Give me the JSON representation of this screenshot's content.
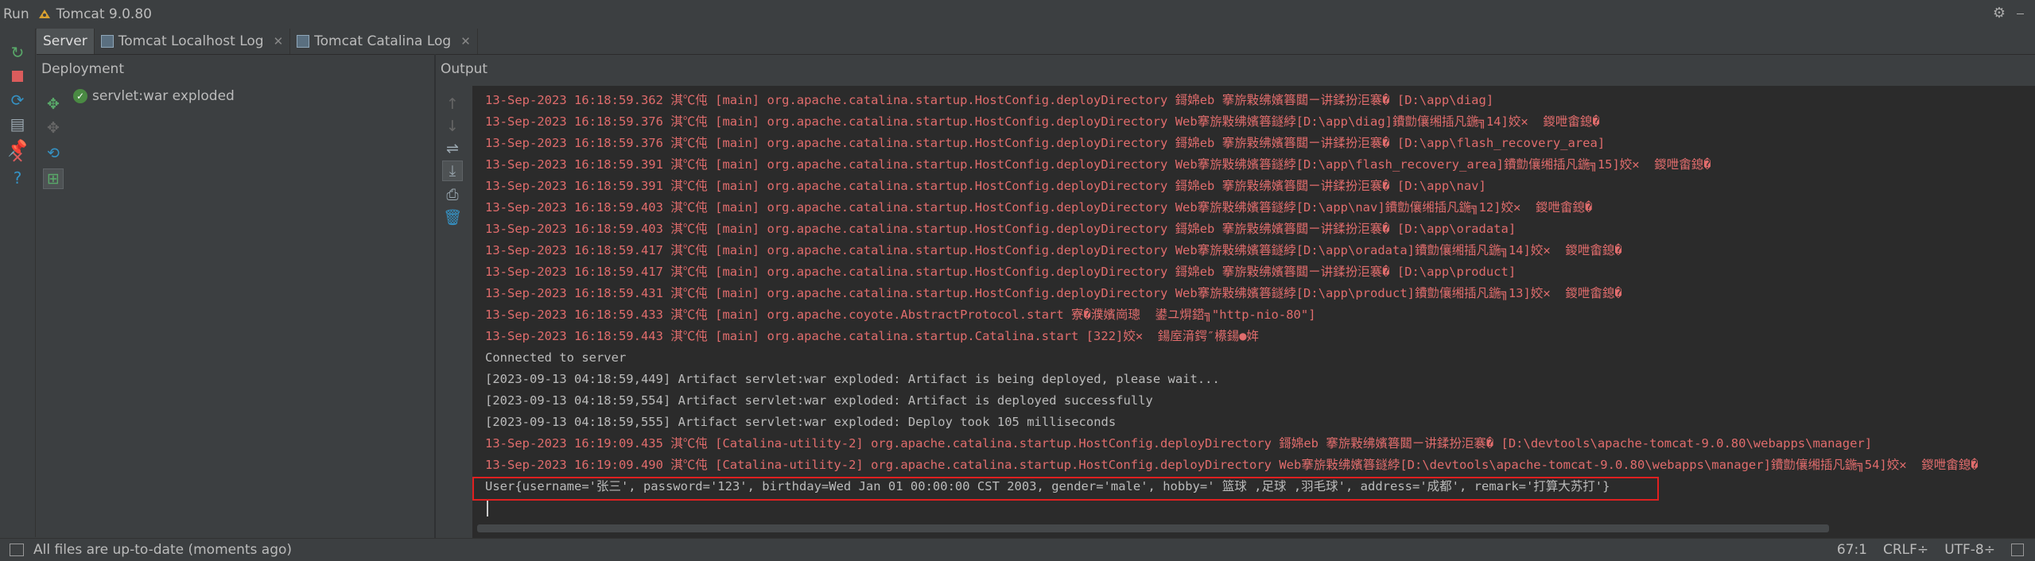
{
  "run_bar": {
    "label": "Run",
    "config_name": "Tomcat 9.0.80",
    "icons": [
      "tomcat-icon",
      "gear-icon",
      "minimize-icon"
    ]
  },
  "tabs": [
    {
      "label": "Server",
      "active": true,
      "closable": false
    },
    {
      "label": "Tomcat Localhost Log",
      "active": false,
      "closable": true
    },
    {
      "label": "Tomcat Catalina Log",
      "active": false,
      "closable": true
    }
  ],
  "deployment": {
    "header": "Deployment",
    "items": [
      {
        "label": "servlet:war exploded",
        "status_icon": "check-circle-icon"
      }
    ]
  },
  "output": {
    "header": "Output",
    "lines": [
      {
        "text": "13-Sep-2023 16:18:59.362 淇℃伅 [main] org.apache.catalina.startup.HostConfig.deployDirectory 鎶婂eb 搴旂敤绋嬪簭閮ㄧ讲鍒扮洰褰� [D:\\app\\diag]",
        "color": "red"
      },
      {
        "text": "13-Sep-2023 16:18:59.376 淇℃伅 [main] org.apache.catalina.startup.HostConfig.deployDirectory Web搴旂敤绋嬪簭鐩綍[D:\\app\\diag]鐨勯儴缃插凡鍦╗14]姣✕  鍐呭畬鎴�",
        "color": "red"
      },
      {
        "text": "13-Sep-2023 16:18:59.376 淇℃伅 [main] org.apache.catalina.startup.HostConfig.deployDirectory 鎶婂eb 搴旂敤绋嬪簭閮ㄧ讲鍒扮洰褰� [D:\\app\\flash_recovery_area]",
        "color": "red"
      },
      {
        "text": "13-Sep-2023 16:18:59.391 淇℃伅 [main] org.apache.catalina.startup.HostConfig.deployDirectory Web搴旂敤绋嬪簭鐩綍[D:\\app\\flash_recovery_area]鐨勯儴缃插凡鍦╗15]姣✕  鍐呭畬鎴�",
        "color": "red"
      },
      {
        "text": "13-Sep-2023 16:18:59.391 淇℃伅 [main] org.apache.catalina.startup.HostConfig.deployDirectory 鎶婂eb 搴旂敤绋嬪簭閮ㄧ讲鍒扮洰褰� [D:\\app\\nav]",
        "color": "red"
      },
      {
        "text": "13-Sep-2023 16:18:59.403 淇℃伅 [main] org.apache.catalina.startup.HostConfig.deployDirectory Web搴旂敤绋嬪簭鐩綍[D:\\app\\nav]鐨勯儴缃插凡鍦╗12]姣✕  鍐呭畬鎴�",
        "color": "red"
      },
      {
        "text": "13-Sep-2023 16:18:59.403 淇℃伅 [main] org.apache.catalina.startup.HostConfig.deployDirectory 鎶婂eb 搴旂敤绋嬪簭閮ㄧ讲鍒扮洰褰� [D:\\app\\oradata]",
        "color": "red"
      },
      {
        "text": "13-Sep-2023 16:18:59.417 淇℃伅 [main] org.apache.catalina.startup.HostConfig.deployDirectory Web搴旂敤绋嬪簭鐩綍[D:\\app\\oradata]鐨勯儴缃插凡鍦╗14]姣✕  鍐呭畬鎴�",
        "color": "red"
      },
      {
        "text": "13-Sep-2023 16:18:59.417 淇℃伅 [main] org.apache.catalina.startup.HostConfig.deployDirectory 鎶婂eb 搴旂敤绋嬪簭閮ㄧ讲鍒扮洰褰� [D:\\app\\product]",
        "color": "red"
      },
      {
        "text": "13-Sep-2023 16:18:59.431 淇℃伅 [main] org.apache.catalina.startup.HostConfig.deployDirectory Web搴旂敤绋嬪簭鐩綍[D:\\app\\product]鐨勯儴缃插凡鍦╗13]姣✕  鍐呭畬鎴�",
        "color": "red"
      },
      {
        "text": "13-Sep-2023 16:18:59.433 淇℃伅 [main] org.apache.coyote.AbstractProtocol.start 寮�濮嬪崗璁  鍙ユ焺鍣╗\"http-nio-80\"]",
        "color": "red"
      },
      {
        "text": "13-Sep-2023 16:18:59.443 淇℃伅 [main] org.apache.catalina.startup.Catalina.start [322]姣✕  鍚庢湇鍔″櫒鍚●姩",
        "color": "red"
      },
      {
        "text": "Connected to server",
        "color": "gray"
      },
      {
        "text": "[2023-09-13 04:18:59,449] Artifact servlet:war exploded: Artifact is being deployed, please wait...",
        "color": "gray"
      },
      {
        "text": "[2023-09-13 04:18:59,554] Artifact servlet:war exploded: Artifact is deployed successfully",
        "color": "gray"
      },
      {
        "text": "[2023-09-13 04:18:59,555] Artifact servlet:war exploded: Deploy took 105 milliseconds",
        "color": "gray"
      },
      {
        "text": "13-Sep-2023 16:19:09.435 淇℃伅 [Catalina-utility-2] org.apache.catalina.startup.HostConfig.deployDirectory 鎶婂eb 搴旂敤绋嬪簭閮ㄧ讲鍒扮洰褰� [D:\\devtools\\apache-tomcat-9.0.80\\webapps\\manager]",
        "color": "red"
      },
      {
        "text": "13-Sep-2023 16:19:09.490 淇℃伅 [Catalina-utility-2] org.apache.catalina.startup.HostConfig.deployDirectory Web搴旂敤绋嬪簭鐩綍[D:\\devtools\\apache-tomcat-9.0.80\\webapps\\manager]鐨勯儴缃插凡鍦╗54]姣✕  鍐呭畬鎴�",
        "color": "red"
      },
      {
        "text": "User{username='张三', password='123', birthday=Wed Jan 01 00:00:00 CST 2003, gender='male', hobby=' 篮球 ,足球 ,羽毛球', address='成都', remark='打算大苏打'}",
        "color": "gray"
      }
    ]
  },
  "status_bar": {
    "message": "All files are up-to-date (moments ago)",
    "position": "67:1",
    "line_separator": "CRLF÷",
    "encoding": "UTF-8÷"
  },
  "colors": {
    "error_text": "#e06c6c",
    "normal_text": "#bbbbbb",
    "highlight_border": "#e02020",
    "console_bg": "#2b2b2b"
  }
}
